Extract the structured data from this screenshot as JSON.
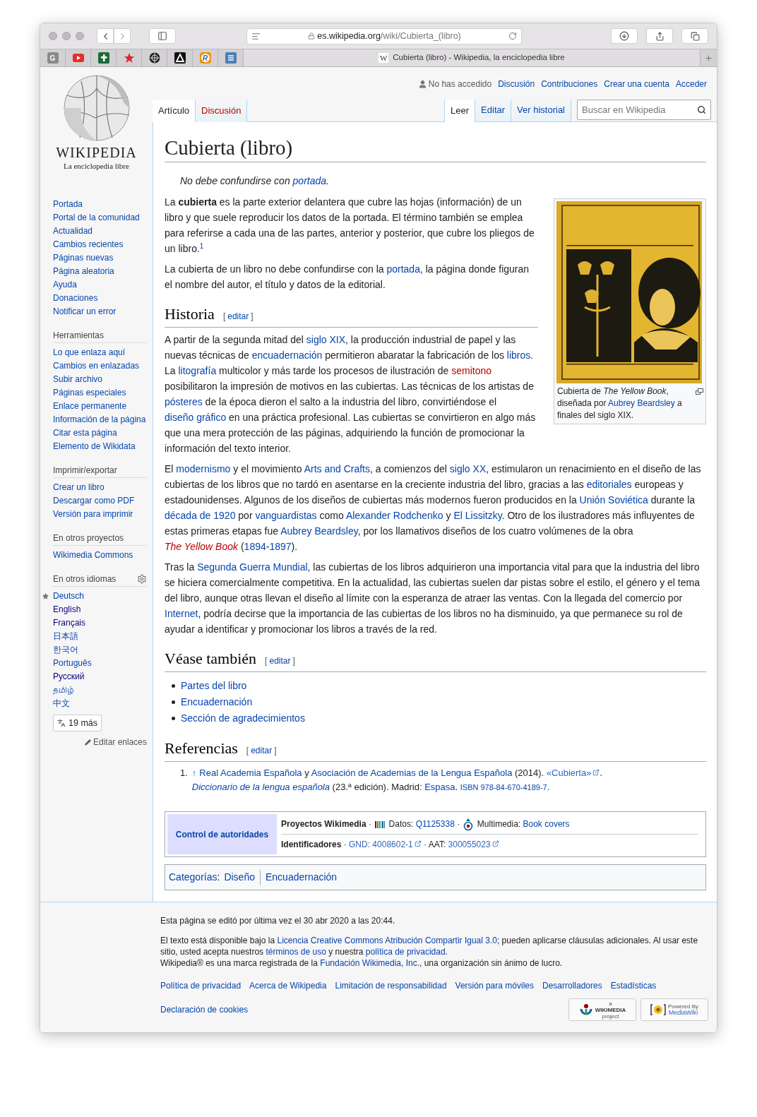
{
  "browser": {
    "url_domain": "es.wikipedia.org",
    "url_path": "/wiki/Cubierta_(libro)",
    "pinned_tabs": [
      {
        "kind": "letter",
        "label": "G"
      },
      {
        "kind": "video"
      },
      {
        "kind": "cross"
      },
      {
        "kind": "star"
      },
      {
        "kind": "wheel"
      },
      {
        "kind": "triangle"
      },
      {
        "kind": "ring",
        "label": "R"
      },
      {
        "kind": "list"
      }
    ],
    "active_tab": {
      "favicon": "W",
      "title": "Cubierta (libro) - Wikipedia, la enciclopedia libre"
    }
  },
  "logo": {
    "wordmark": "WIKIPEDIA",
    "tagline": "La enciclopedia libre"
  },
  "sidebar": {
    "nav": [
      "Portada",
      "Portal de la comunidad",
      "Actualidad",
      "Cambios recientes",
      "Páginas nuevas",
      "Página aleatoria",
      "Ayuda",
      "Donaciones",
      "Notificar un error"
    ],
    "portlets": [
      {
        "heading": "Herramientas",
        "items": [
          "Lo que enlaza aquí",
          "Cambios en enlazadas",
          "Subir archivo",
          "Páginas especiales",
          "Enlace permanente",
          "Información de la página",
          "Citar esta página",
          "Elemento de Wikidata"
        ]
      },
      {
        "heading": "Imprimir/exportar",
        "items": [
          "Crear un libro",
          "Descargar como PDF",
          "Versión para imprimir"
        ]
      },
      {
        "heading": "En otros proyectos",
        "items": [
          "Wikimedia Commons"
        ]
      }
    ],
    "languages": {
      "heading": "En otros idiomas",
      "items": [
        {
          "label": "Deutsch",
          "featured": true,
          "visited": false
        },
        {
          "label": "English",
          "featured": false,
          "visited": true
        },
        {
          "label": "Français",
          "featured": false,
          "visited": true
        },
        {
          "label": "日本語",
          "featured": false,
          "visited": false
        },
        {
          "label": "한국어",
          "featured": false,
          "visited": false
        },
        {
          "label": "Português",
          "featured": false,
          "visited": false
        },
        {
          "label": "Русский",
          "featured": false,
          "visited": true
        },
        {
          "label": "தமிழ்",
          "featured": false,
          "visited": false
        },
        {
          "label": "中文",
          "featured": false,
          "visited": false
        }
      ],
      "more_button": "19 más",
      "edit_links": "Editar enlaces"
    }
  },
  "personal_tools": {
    "status": "No has accedido",
    "links": [
      "Discusión",
      "Contribuciones",
      "Crear una cuenta",
      "Acceder"
    ]
  },
  "tabs": {
    "left": [
      {
        "label": "Artículo",
        "selected": true,
        "missing": false
      },
      {
        "label": "Discusión",
        "selected": false,
        "missing": true
      }
    ],
    "right": [
      {
        "label": "Leer",
        "selected": true
      },
      {
        "label": "Editar",
        "selected": false
      },
      {
        "label": "Ver historial",
        "selected": false
      }
    ]
  },
  "search": {
    "placeholder": "Buscar en Wikipedia"
  },
  "article": {
    "title": "Cubierta (libro)",
    "hatnote": [
      {
        "kind": "text",
        "text": "No debe confundirse con "
      },
      {
        "kind": "link",
        "text": "portada"
      },
      {
        "kind": "text",
        "text": "."
      }
    ],
    "infobox": {
      "caption": [
        {
          "kind": "text",
          "text": "Cubierta de *The Yellow Book*, diseñada por "
        },
        {
          "kind": "link",
          "text": "Aubrey Beardsley"
        },
        {
          "kind": "text",
          "text": " a finales del siglo XIX."
        }
      ]
    },
    "intro": [
      [
        {
          "kind": "text",
          "text": "La **cubierta** es la parte exterior delantera que cubre las hojas (información) de un libro y que suele reproducir los datos de la portada. El término también se emplea para referirse a cada una de las partes, anterior y posterior, que cubre los pliegos de un libro."
        },
        {
          "kind": "sup",
          "text": "1"
        }
      ],
      [
        {
          "kind": "text",
          "text": "La cubierta de un libro no debe confundirse con la "
        },
        {
          "kind": "link",
          "text": "portada"
        },
        {
          "kind": "text",
          "text": ", la página donde figuran el nombre del autor, el título y datos de la editorial."
        }
      ]
    ],
    "sections": [
      {
        "kind": "paragraphs",
        "title": "Historia",
        "edit": {
          "open": "[",
          "label": "editar",
          "close": "]"
        },
        "paragraphs": [
          [
            {
              "kind": "text",
              "text": "A partir de la segunda mitad del "
            },
            {
              "kind": "link",
              "text": "siglo XIX"
            },
            {
              "kind": "text",
              "text": ", la producción industrial de papel y las nuevas técnicas de "
            },
            {
              "kind": "link",
              "text": "encuadernación"
            },
            {
              "kind": "text",
              "text": " permitieron abaratar la fabricación de los "
            },
            {
              "kind": "link",
              "text": "libros"
            },
            {
              "kind": "text",
              "text": ". La "
            },
            {
              "kind": "link",
              "text": "litografía"
            },
            {
              "kind": "text",
              "text": " multicolor y más tarde los procesos de ilustración de "
            },
            {
              "kind": "new",
              "text": "semitono"
            },
            {
              "kind": "text",
              "text": " posibilitaron la impresión de motivos en las cubiertas. Las técnicas de los artistas de "
            },
            {
              "kind": "link",
              "text": "pósteres"
            },
            {
              "kind": "text",
              "text": " de la época dieron el salto a la industria del libro, convirtiéndose el "
            },
            {
              "kind": "link",
              "text": "diseño gráfico"
            },
            {
              "kind": "text",
              "text": " en una práctica profesional. Las cubiertas se convirtieron en algo más que una mera protección de las páginas, adquiriendo la función de promocionar la información del texto interior."
            }
          ],
          [
            {
              "kind": "text",
              "text": "El "
            },
            {
              "kind": "link",
              "text": "modernismo"
            },
            {
              "kind": "text",
              "text": " y el movimiento "
            },
            {
              "kind": "link",
              "text": "Arts and Crafts"
            },
            {
              "kind": "text",
              "text": ", a comienzos del "
            },
            {
              "kind": "link",
              "text": "siglo XX"
            },
            {
              "kind": "text",
              "text": ", estimularon un renacimiento en el diseño de las cubiertas de los libros que no tardó en asentarse en la creciente industria del libro, gracias a las "
            },
            {
              "kind": "link",
              "text": "editoriales"
            },
            {
              "kind": "text",
              "text": " europeas y estadounidenses. Algunos de los diseños de cubiertas más modernos fueron producidos en la "
            },
            {
              "kind": "link",
              "text": "Unión Soviética"
            },
            {
              "kind": "text",
              "text": " durante la "
            },
            {
              "kind": "link",
              "text": "década de 1920"
            },
            {
              "kind": "text",
              "text": " por "
            },
            {
              "kind": "link",
              "text": "vanguardistas"
            },
            {
              "kind": "text",
              "text": " como "
            },
            {
              "kind": "link",
              "text": "Alexander Rodchenko"
            },
            {
              "kind": "text",
              "text": " y "
            },
            {
              "kind": "link",
              "text": "El Lissitzky"
            },
            {
              "kind": "text",
              "text": ". Otro de los ilustradores más influyentes de estas primeras etapas fue "
            },
            {
              "kind": "link",
              "text": "Aubrey Beardsley"
            },
            {
              "kind": "text",
              "text": ", por los llamativos diseños de los cuatro volúmenes de la obra "
            },
            {
              "kind": "new",
              "text": "The Yellow Book",
              "italic": true
            },
            {
              "kind": "text",
              "text": " ("
            },
            {
              "kind": "link",
              "text": "1894"
            },
            {
              "kind": "text",
              "text": "-"
            },
            {
              "kind": "link",
              "text": "1897"
            },
            {
              "kind": "text",
              "text": ")."
            }
          ],
          [
            {
              "kind": "text",
              "text": "Tras la "
            },
            {
              "kind": "link",
              "text": "Segunda Guerra Mundial"
            },
            {
              "kind": "text",
              "text": ", las cubiertas de los libros adquirieron una importancia vital para que la industria del libro se hiciera comercialmente competitiva. En la actualidad, las cubiertas suelen dar pistas sobre el estilo, el género y el tema del libro, aunque otras llevan el diseño al límite con la esperanza de atraer las ventas. Con la llegada del comercio por "
            },
            {
              "kind": "link",
              "text": "Internet"
            },
            {
              "kind": "text",
              "text": ", podría decirse que la importancia de las cubiertas de los libros no ha disminuido, ya que permanece su rol de ayudar a identificar y promocionar los libros a través de la red."
            }
          ]
        ]
      },
      {
        "kind": "bullets",
        "title": "Véase también",
        "edit": {
          "open": "[",
          "label": "editar",
          "close": "]"
        },
        "items": [
          "Partes del libro",
          "Encuadernación",
          "Sección de agradecimientos"
        ]
      },
      {
        "kind": "references",
        "title": "Referencias",
        "edit": {
          "open": "[",
          "label": "editar",
          "close": "]"
        },
        "items": [
          {
            "number": "1.",
            "segments": [
              {
                "kind": "backlink",
                "text": "↑"
              },
              {
                "kind": "link",
                "text": "Real Academia Española"
              },
              {
                "kind": "text",
                "text": " y "
              },
              {
                "kind": "link",
                "text": "Asociación de Academias de la Lengua Española"
              },
              {
                "kind": "text",
                "text": " (2014). "
              },
              {
                "kind": "ext",
                "text": "«Cubierta»"
              },
              {
                "kind": "text",
                "text": ". "
              },
              {
                "kind": "link",
                "text": "Diccionario de la lengua española",
                "italic": true
              },
              {
                "kind": "text",
                "text": " (23.ª edición). Madrid: "
              },
              {
                "kind": "link",
                "text": "Espasa"
              },
              {
                "kind": "text",
                "text": ". "
              },
              {
                "kind": "small",
                "text": "ISBN 978-84-670-4189-7"
              },
              {
                "kind": "text",
                "text": "."
              }
            ]
          }
        ]
      }
    ],
    "authority": {
      "heading": "Control de autoridades",
      "rows": [
        {
          "label": "Proyectos Wikimedia",
          "content": [
            {
              "kind": "text",
              "text": " · "
            },
            {
              "kind": "wikidata"
            },
            {
              "kind": "text",
              "text": " Datos: "
            },
            {
              "kind": "link",
              "text": "Q1125338"
            },
            {
              "kind": "text",
              "text": " · "
            },
            {
              "kind": "commons"
            },
            {
              "kind": "text",
              "text": " Multimedia: "
            },
            {
              "kind": "link",
              "text": "Book covers"
            }
          ]
        },
        {
          "label": "Identificadores",
          "content": [
            {
              "kind": "text",
              "text": " · "
            },
            {
              "kind": "ext",
              "text": "GND: 4008602-1"
            },
            {
              "kind": "text",
              "text": " · AAT: "
            },
            {
              "kind": "ext",
              "text": "300055023"
            }
          ]
        }
      ]
    },
    "categories": {
      "label": "Categorías",
      "colon": ":",
      "items": [
        "Diseño",
        "Encuadernación"
      ]
    }
  },
  "footer": {
    "last_edit": "Esta página se editó por última vez el 30 abr 2020 a las 20:44.",
    "license": [
      {
        "kind": "text",
        "text": "El texto está disponible bajo la "
      },
      {
        "kind": "link",
        "text": "Licencia Creative Commons Atribución Compartir Igual 3.0"
      },
      {
        "kind": "text",
        "text": "; pueden aplicarse cláusulas adicionales. Al usar este sitio, usted acepta nuestros "
      },
      {
        "kind": "link",
        "text": "términos de uso"
      },
      {
        "kind": "text",
        "text": " y nuestra "
      },
      {
        "kind": "link",
        "text": "política de privacidad"
      },
      {
        "kind": "text",
        "text": "."
      }
    ],
    "trademark": [
      {
        "kind": "text",
        "text": "Wikipedia® es una marca registrada de la "
      },
      {
        "kind": "link",
        "text": "Fundación Wikimedia, Inc."
      },
      {
        "kind": "text",
        "text": ", una organización sin ánimo de lucro."
      }
    ],
    "links": [
      "Política de privacidad",
      "Acerca de Wikipedia",
      "Limitación de responsabilidad",
      "Versión para móviles",
      "Desarrolladores",
      "Estadísticas"
    ],
    "cookies": "Declaración de cookies",
    "badges": [
      {
        "kind": "wikimedia",
        "small": "a",
        "big": "WIKIMEDIA",
        "sub": "project"
      },
      {
        "kind": "mediawiki",
        "small": "Powered By",
        "big": "MediaWiki"
      }
    ]
  }
}
